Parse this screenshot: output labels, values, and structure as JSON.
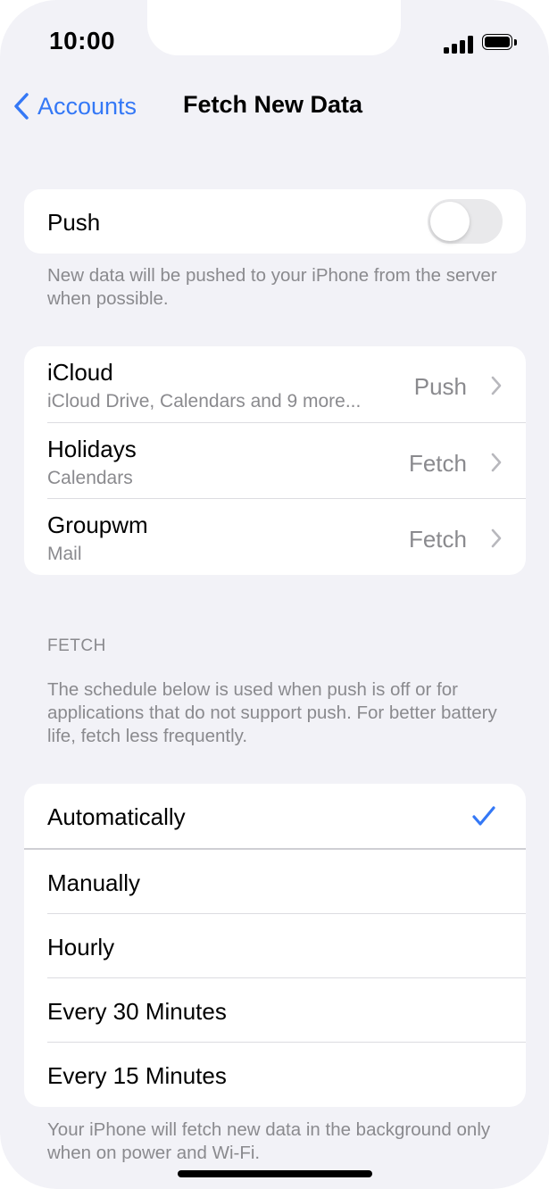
{
  "status_bar": {
    "time": "10:00"
  },
  "nav": {
    "back_label": "Accounts",
    "title": "Fetch New Data"
  },
  "push_section": {
    "label": "Push",
    "toggle_on": false,
    "footer": "New data will be pushed to your iPhone from the server when possible."
  },
  "accounts": [
    {
      "name": "iCloud",
      "detail": "iCloud Drive, Calendars and 9 more...",
      "value": "Push"
    },
    {
      "name": "Holidays",
      "detail": "Calendars",
      "value": "Fetch"
    },
    {
      "name": "Groupwm",
      "detail": "Mail",
      "value": "Fetch"
    }
  ],
  "fetch_section": {
    "header": "FETCH",
    "description": "The schedule below is used when push is off or for applications that do not support push. For better battery life, fetch less frequently.",
    "options": [
      "Automatically",
      "Manually",
      "Hourly",
      "Every 30 Minutes",
      "Every 15 Minutes"
    ],
    "selected": "Automatically",
    "footer": "Your iPhone will fetch new data in the background only when on power and Wi-Fi."
  },
  "colors": {
    "accent": "#3478f6",
    "background": "#f2f2f7",
    "secondary_text": "#8a8a8e"
  },
  "icons": [
    "chevron-left-icon",
    "chevron-right-icon",
    "checkmark-icon",
    "signal-icon",
    "battery-icon"
  ]
}
